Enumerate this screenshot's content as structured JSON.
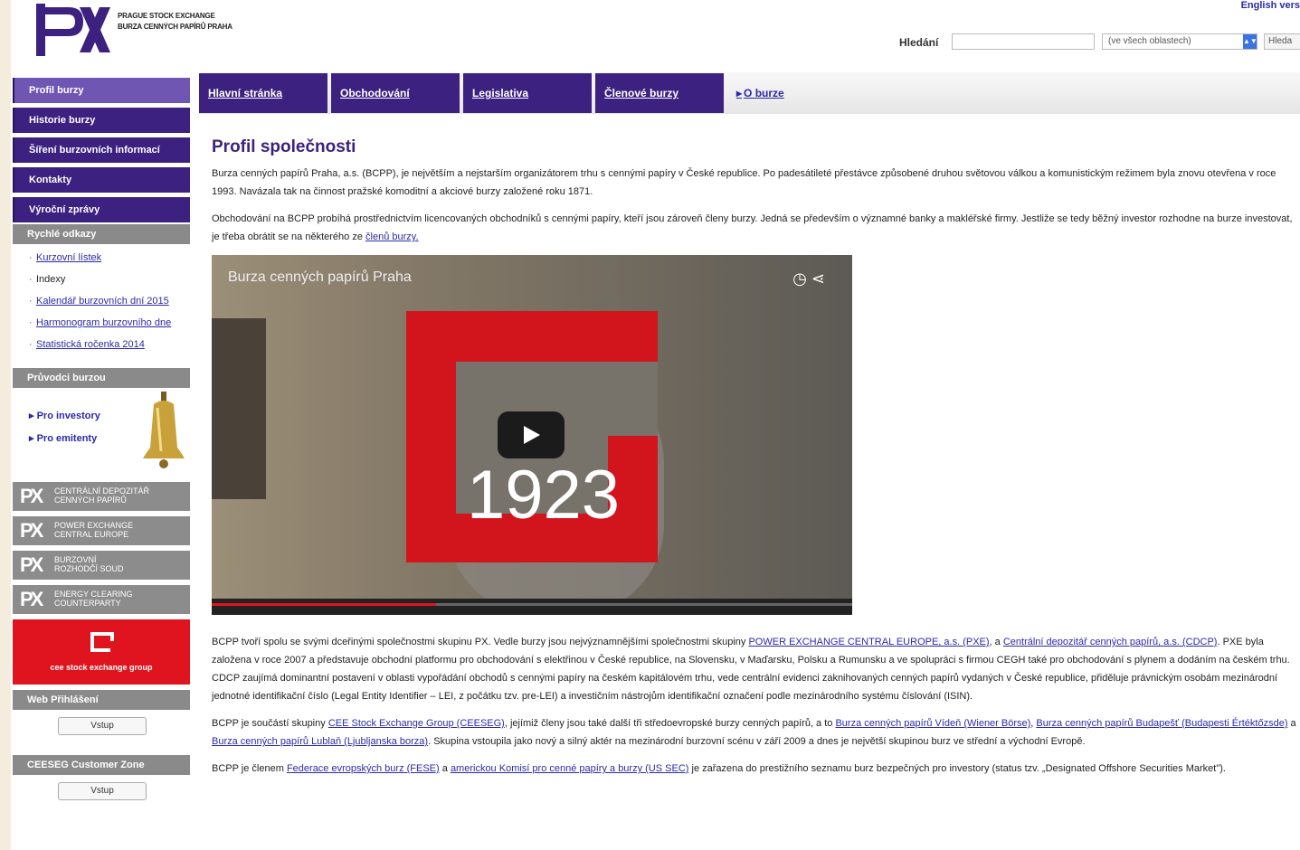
{
  "header": {
    "logo_text_line1": "PRAGUE STOCK EXCHANGE",
    "logo_text_line2": "BURZA CENNÝCH PAPÍRŮ PRAHA",
    "english_link": "English vers",
    "search_label": "Hledání",
    "search_value": "",
    "search_scope": "(ve všech oblastech)",
    "search_button": "Hleda"
  },
  "tabs": [
    "Hlavní stránka",
    "Obchodování",
    "Legislativa",
    "Členové burzy",
    "O burze"
  ],
  "sidebar": {
    "items": [
      "Profil burzy",
      "Historie burzy",
      "Šíření burzovních informací",
      "Kontakty",
      "Výroční zprávy"
    ],
    "quick_links_title": "Rychlé odkazy",
    "quick_links": [
      "Kurzovní lístek",
      "Indexy",
      "Kalendář burzovních dní 2015",
      "Harmonogram burzovního dne",
      "Statistická ročenka 2014"
    ],
    "guide_title": "Průvodci burzou",
    "guide_links": [
      "Pro investory",
      "Pro emitenty"
    ],
    "partners": [
      {
        "line1": "Centrální depozitář",
        "line2": "cenných papírů"
      },
      {
        "line1": "Power exchange",
        "line2": "central europe"
      },
      {
        "line1": "Burzovní",
        "line2": "rozhodčí soud"
      },
      {
        "line1": "Energy clearing",
        "line2": "counterparty"
      }
    ],
    "cee_text": "cee stock exchange group",
    "login_title": "Web Přihlášení",
    "login_button": "Vstup",
    "zone_title": "CEESEG Customer Zone",
    "zone_button": "Vstup"
  },
  "main": {
    "title": "Profil společnosti",
    "para1": "Burza cenných papírů Praha, a.s. (BCPP), je největším a nejstarším organizátorem trhu s cennými papíry v České republice. Po padesátileté přestávce způsobené druhou světovou válkou a komunistickým režimem byla znovu otevřena v roce 1993. Navázala tak na činnost pražské komoditní a akciové burzy založené roku 1871.",
    "para2_text": "Obchodování na BCPP probíhá prostřednictvím licencovaných obchodníků s cennými papíry, kteří jsou zároveň členy burzy. Jedná se především o významné banky a makléřské firmy. Jestliže se tedy běžný investor rozhodne na burze investovat, je třeba obrátit se na některého ze",
    "para2_link": "členů burzy.",
    "video_title": "Burza cenných papírů Praha",
    "video_year": "1923",
    "video_progress": 0.35,
    "para3_a": "BCPP tvoří spolu se svými dceřinými společnostmi skupinu PX. Vedle burzy jsou nejvýznamnějšími společnostmi skupiny",
    "para3_link1": "POWER EXCHANGE CENTRAL EUROPE, a.s. (PXE)",
    "para3_b": ", a",
    "para3_link2": "Centrální depozitář cenných papírů, a.s. (CDCP)",
    "para3_c": ". PXE byla založena v roce 2007 a představuje obchodní platformu pro obchodování s elektřinou v České republice, na Slovensku, v Maďarsku, Polsku a Rumunsku a ve spolupráci s firmou CEGH také pro obchodování s plynem a dodáním na českém trhu. CDCP zaujímá dominantní postavení v oblasti vypořádání obchodů s cennými papíry na českém kapitálovém trhu, vede centrální evidenci zaknihovaných cenných papírů vydaných v České republice, přiděluje právnickým osobám mezinárodní jednotné identifikační číslo (Legal Entity Identifier – LEI, z počátku tzv. pre-LEI) a investičním nástrojům identifikační označení podle mezinárodního systému číslování (ISIN).",
    "para4_a": "BCPP je součástí skupiny",
    "para4_link1": "CEE Stock Exchange Group (CEESEG)",
    "para4_b": ", jejímiž členy jsou také další tři středoevropské burzy cenných papírů, a to",
    "para4_link2": "Burza cenných papírů Vídeň (Wiener Börse)",
    "para4_c": ",",
    "para4_link3": "Burza cenných papírů Budapešť (Budapesti Értéktőzsde)",
    "para4_d": "a",
    "para4_link4": "Burza cenných papírů Lublaň (Ljubljanska borza)",
    "para4_e": ". Skupina vstoupila jako nový a silný aktér na mezinárodní burzovní scénu v září 2009 a dnes je největší skupinou burz ve střední a východní Evropě.",
    "para5_a": "BCPP je členem",
    "para5_link1": "Federace evropských burz (FESE)",
    "para5_b": "a",
    "para5_link2": "americkou Komisí pro cenné papíry a burzy (US SEC)",
    "para5_c": "je zařazena do prestižního seznamu burz bezpečných pro investory (status tzv. „Designated Offshore Securities Market\")."
  },
  "colors": {
    "brand_purple": "#3c2180",
    "active_purple": "#7056b3",
    "link_blue": "#2a2aa8",
    "cee_red": "#e0141e"
  }
}
